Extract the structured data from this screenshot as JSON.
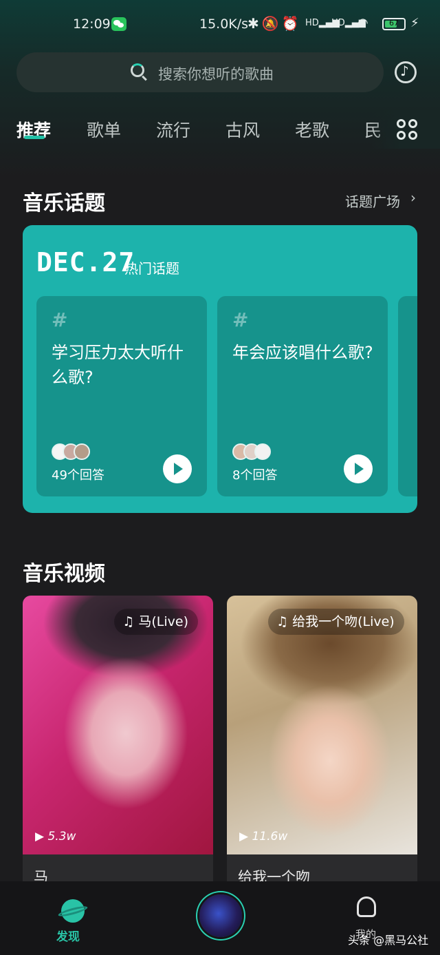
{
  "status_bar": {
    "time": "12:09",
    "net_speed": "15.0K/s",
    "battery_level": "67",
    "battery_fraction": 0.67,
    "net_tags": [
      "HD",
      "HD"
    ]
  },
  "search": {
    "placeholder": "搜索你想听的歌曲"
  },
  "tabs": [
    {
      "label": "推荐",
      "active": true
    },
    {
      "label": "歌单",
      "active": false
    },
    {
      "label": "流行",
      "active": false
    },
    {
      "label": "古风",
      "active": false
    },
    {
      "label": "老歌",
      "active": false
    },
    {
      "label": "民",
      "active": false
    }
  ],
  "topics": {
    "title": "音乐话题",
    "more_link": "话题广场",
    "date": "DEC.27",
    "tag": "热门话题",
    "items": [
      {
        "question": "学习压力太大听什么歌?",
        "answers": "49个回答"
      },
      {
        "question": "年会应该唱什么歌?",
        "answers": "8个回答"
      }
    ]
  },
  "videos": {
    "title": "音乐视频",
    "items": [
      {
        "tag": "马(Live)",
        "plays": "5.3w",
        "title": "马"
      },
      {
        "tag": "给我一个吻(Live)",
        "plays": "11.6w",
        "title": "给我一个吻"
      }
    ]
  },
  "bottom_nav": {
    "discover_label": "发现",
    "mine_label": "我的"
  },
  "watermark": "头条 @黑马公社",
  "colors": {
    "accent": "#22c3a8",
    "topic_card": "#1db3ac",
    "background": "#1c1c1e"
  }
}
